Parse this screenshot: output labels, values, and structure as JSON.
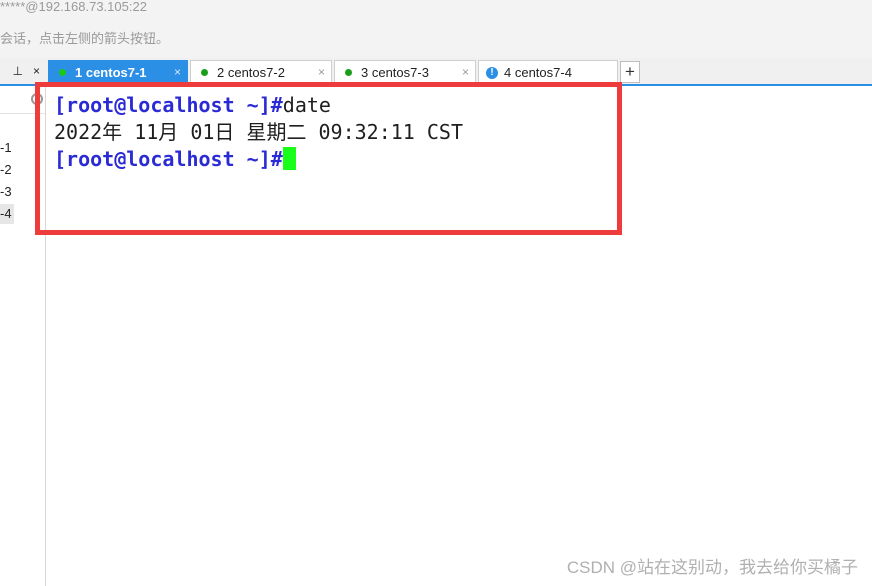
{
  "window": {
    "title": "*****@192.168.73.105:22",
    "hint": "会话，点击左侧的箭头按钮。"
  },
  "side_tools": {
    "pin_glyph": "⊥",
    "close_glyph": "×"
  },
  "tabs": [
    {
      "label": "1 centos7-1",
      "status": "connected",
      "active": true
    },
    {
      "label": "2 centos7-2",
      "status": "connected",
      "active": false
    },
    {
      "label": "3 centos7-3",
      "status": "connected",
      "active": false
    },
    {
      "label": "4 centos7-4",
      "status": "warning",
      "active": false
    }
  ],
  "tab_close_glyph": "×",
  "add_tab_glyph": "+",
  "warning_glyph": "!",
  "sessions": [
    {
      "label": "-1"
    },
    {
      "label": "-2"
    },
    {
      "label": "-3"
    },
    {
      "label": "-4"
    }
  ],
  "terminal": {
    "prompt": "[root@localhost ~]#",
    "command": "date",
    "output": "2022年 11月 01日 星期二 09:32:11 CST"
  },
  "watermark": "CSDN @站在这别动，我去给你买橘子",
  "colors": {
    "accent": "#2b8fe6",
    "prompt": "#2b2bd6",
    "cursor": "#19ff19",
    "highlight": "#ee3b3b"
  }
}
